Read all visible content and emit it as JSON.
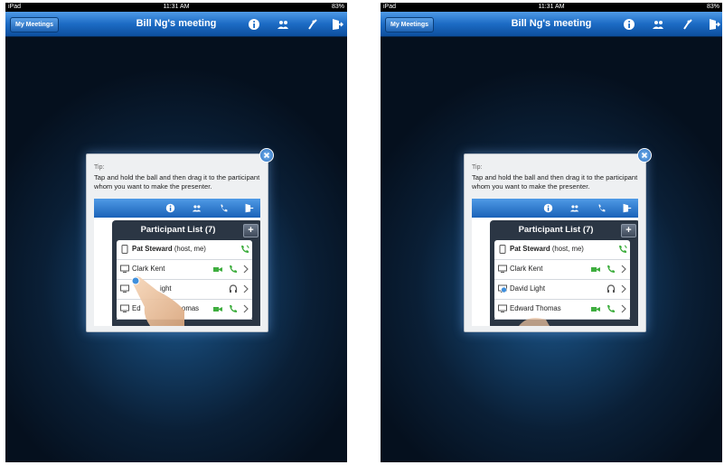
{
  "screens": [
    {
      "status": {
        "carrier": "iPad",
        "time": "11:31 AM",
        "battery": "83%"
      },
      "nav": {
        "back_label": "My Meetings",
        "title": "Bill Ng's meeting"
      },
      "tip": {
        "label": "Tip:",
        "text": "Tap and hold the ball and then drag it to the participant whom you want to make the presenter.",
        "panel_title": "Participant List (7)",
        "add_label": "+",
        "participants": [
          {
            "name": "Pat Steward",
            "suffix": "(host, me)"
          },
          {
            "name": "Clark Kent",
            "suffix": ""
          },
          {
            "name": "ight",
            "suffix": ""
          },
          {
            "name": "Ed",
            "suffix": "omas"
          }
        ]
      }
    },
    {
      "status": {
        "carrier": "iPad",
        "time": "11:31 AM",
        "battery": "83%"
      },
      "nav": {
        "back_label": "My Meetings",
        "title": "Bill Ng's meeting"
      },
      "tip": {
        "label": "Tip:",
        "text": "Tap and hold the ball and then drag it to the participant whom you want to make the presenter.",
        "panel_title": "Participant List (7)",
        "add_label": "+",
        "participants": [
          {
            "name": "Pat Steward",
            "suffix": "(host, me)"
          },
          {
            "name": "Clark Kent",
            "suffix": ""
          },
          {
            "name": "David Light",
            "suffix": ""
          },
          {
            "name": "Edward Thomas",
            "suffix": ""
          }
        ]
      }
    }
  ],
  "colors": {
    "nav_blue": "#1c6bc4",
    "background_dark": "#0a1f36",
    "panel": "#2b3644",
    "video_green": "#3fae3f"
  },
  "icons": [
    "info-icon",
    "participants-icon",
    "phone-icon",
    "leave-icon",
    "close-icon",
    "ipad-icon",
    "computer-icon",
    "phone-audio-icon",
    "video-icon",
    "headset-icon",
    "chevron-right-icon",
    "presenter-ball-icon"
  ]
}
